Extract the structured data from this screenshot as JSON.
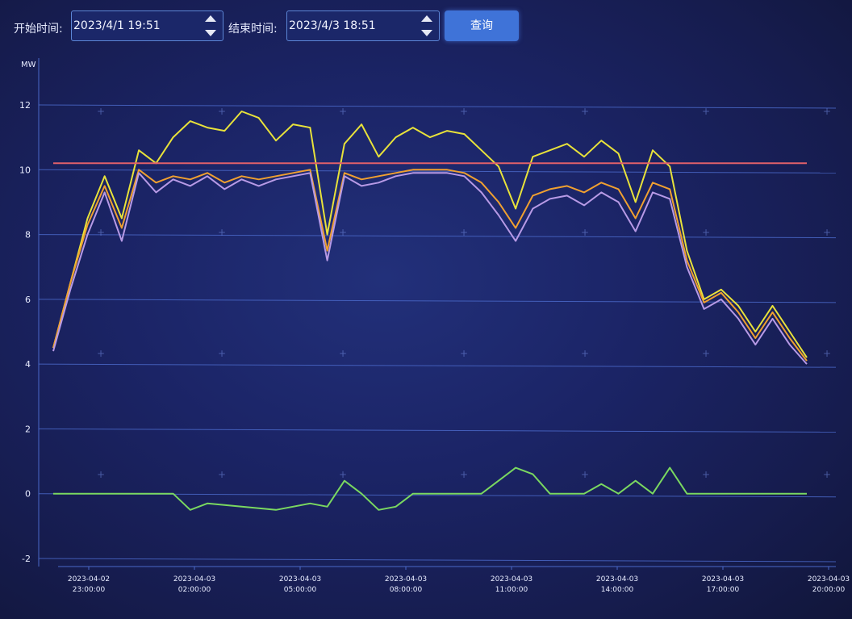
{
  "query_bar": {
    "start_label": "开始时间:",
    "start_value": "2023/4/1 19:51",
    "end_label": "结束时间:",
    "end_value": "2023/4/3 18:51",
    "query_button": "查询"
  },
  "chart_data": {
    "type": "line",
    "unit_label": "MW",
    "y_ticks": [
      "12",
      "10",
      "8",
      "6",
      "4",
      "2",
      "0",
      "-2"
    ],
    "ylim": [
      -2,
      12
    ],
    "x_ticks": [
      {
        "date": "2023-04-02",
        "time": "23:00:00"
      },
      {
        "date": "2023-04-03",
        "time": "02:00:00"
      },
      {
        "date": "2023-04-03",
        "time": "05:00:00"
      },
      {
        "date": "2023-04-03",
        "time": "08:00:00"
      },
      {
        "date": "2023-04-03",
        "time": "11:00:00"
      },
      {
        "date": "2023-04-03",
        "time": "14:00:00"
      },
      {
        "date": "2023-04-03",
        "time": "17:00:00"
      },
      {
        "date": "2023-04-03",
        "time": "20:00:00"
      }
    ],
    "grid": true,
    "colors": {
      "yellow": "#e8e23a",
      "orange": "#f0a030",
      "purple": "#b79ae6",
      "red": "#e0606a",
      "green": "#7ad860",
      "grid": "#4a68c8",
      "axis_text": "#e8ecff"
    },
    "series": [
      {
        "color": "yellow",
        "x": [
          22.5,
          23.0,
          23.5,
          24.0,
          24.5,
          25.0,
          25.5,
          26.0,
          26.5,
          27.0,
          27.5,
          28.0,
          28.5,
          29.0,
          29.5,
          30.0,
          30.5,
          31.0,
          31.5,
          32.0,
          32.5,
          33.0,
          33.5,
          34.0,
          34.5,
          35.0,
          35.5,
          36.0,
          36.5,
          37.0,
          37.5,
          38.0,
          38.5,
          39.0,
          39.5,
          40.0,
          40.5,
          41.0,
          41.5,
          42.0,
          42.5,
          43.0,
          43.5,
          44.0,
          44.5
        ],
        "values": [
          4.5,
          6.5,
          8.5,
          9.8,
          8.5,
          10.6,
          10.2,
          11.0,
          11.5,
          11.3,
          11.2,
          11.8,
          11.6,
          10.9,
          11.4,
          11.3,
          8.0,
          10.8,
          11.4,
          10.4,
          11.0,
          11.3,
          11.0,
          11.2,
          11.1,
          10.6,
          10.1,
          8.8,
          10.4,
          10.6,
          10.8,
          10.4,
          10.9,
          10.5,
          9.0,
          10.6,
          10.1,
          7.5,
          6.0,
          6.3,
          5.8,
          5.0,
          5.8,
          5.0,
          4.2
        ]
      },
      {
        "color": "orange",
        "x": [
          22.5,
          23.0,
          23.5,
          24.0,
          24.5,
          25.0,
          25.5,
          26.0,
          26.5,
          27.0,
          27.5,
          28.0,
          28.5,
          29.0,
          29.5,
          30.0,
          30.5,
          31.0,
          31.5,
          32.0,
          32.5,
          33.0,
          33.5,
          34.0,
          34.5,
          35.0,
          35.5,
          36.0,
          36.5,
          37.0,
          37.5,
          38.0,
          38.5,
          39.0,
          39.5,
          40.0,
          40.5,
          41.0,
          41.5,
          42.0,
          42.5,
          43.0,
          43.5,
          44.0,
          44.5
        ],
        "values": [
          4.5,
          6.5,
          8.3,
          9.5,
          8.2,
          10.0,
          9.6,
          9.8,
          9.7,
          9.9,
          9.6,
          9.8,
          9.7,
          9.8,
          9.9,
          10.0,
          7.5,
          9.9,
          9.7,
          9.8,
          9.9,
          10.0,
          10.0,
          10.0,
          9.9,
          9.6,
          9.0,
          8.2,
          9.2,
          9.4,
          9.5,
          9.3,
          9.6,
          9.4,
          8.5,
          9.6,
          9.4,
          7.2,
          5.9,
          6.2,
          5.6,
          4.8,
          5.6,
          4.8,
          4.1
        ]
      },
      {
        "color": "purple",
        "x": [
          22.5,
          23.0,
          23.5,
          24.0,
          24.5,
          25.0,
          25.5,
          26.0,
          26.5,
          27.0,
          27.5,
          28.0,
          28.5,
          29.0,
          29.5,
          30.0,
          30.5,
          31.0,
          31.5,
          32.0,
          32.5,
          33.0,
          33.5,
          34.0,
          34.5,
          35.0,
          35.5,
          36.0,
          36.5,
          37.0,
          37.5,
          38.0,
          38.5,
          39.0,
          39.5,
          40.0,
          40.5,
          41.0,
          41.5,
          42.0,
          42.5,
          43.0,
          43.5,
          44.0,
          44.5
        ],
        "values": [
          4.4,
          6.3,
          8.0,
          9.3,
          7.8,
          9.9,
          9.3,
          9.7,
          9.5,
          9.8,
          9.4,
          9.7,
          9.5,
          9.7,
          9.8,
          9.9,
          7.2,
          9.8,
          9.5,
          9.6,
          9.8,
          9.9,
          9.9,
          9.9,
          9.8,
          9.3,
          8.6,
          7.8,
          8.8,
          9.1,
          9.2,
          8.9,
          9.3,
          9.0,
          8.1,
          9.3,
          9.1,
          7.0,
          5.7,
          6.0,
          5.4,
          4.6,
          5.4,
          4.6,
          4.0
        ]
      },
      {
        "color": "red",
        "x": [
          22.5,
          44.5
        ],
        "values": [
          10.2,
          10.2
        ]
      },
      {
        "color": "green",
        "x": [
          22.5,
          26.0,
          26.5,
          27.0,
          28.0,
          29.0,
          30.0,
          30.5,
          31.0,
          31.5,
          32.0,
          32.5,
          33.0,
          34.0,
          35.0,
          35.5,
          36.0,
          36.5,
          37.0,
          38.0,
          38.5,
          39.0,
          39.5,
          40.0,
          40.5,
          41.0,
          44.5
        ],
        "values": [
          0,
          0,
          -0.5,
          -0.3,
          -0.4,
          -0.5,
          -0.3,
          -0.4,
          0.4,
          0,
          -0.5,
          -0.4,
          0,
          0,
          0,
          0.4,
          0.8,
          0.6,
          0,
          0,
          0.3,
          0,
          0.4,
          0,
          0.8,
          0,
          0
        ]
      }
    ]
  }
}
